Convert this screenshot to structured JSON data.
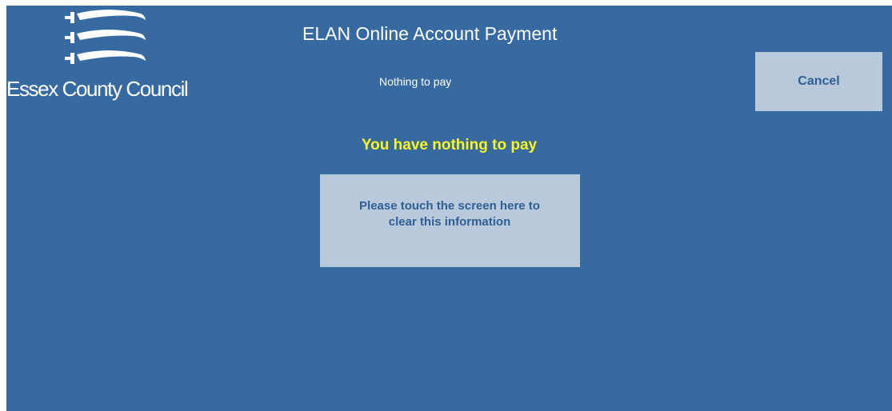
{
  "header": {
    "logo_text": "Essex County Council",
    "title": "ELAN Online Account Payment",
    "subtitle": "Nothing to pay",
    "cancel_label": "Cancel"
  },
  "main": {
    "message": "You have nothing to pay",
    "clear_label": "Please touch the screen here to clear this information"
  },
  "colors": {
    "background": "#376aa1",
    "button_fill": "#b9c9dc",
    "button_text": "#2f5e95",
    "message_text": "#fbf720",
    "logo": "#ffffff"
  },
  "icons": {
    "logo_mark": "three-seaxes-icon"
  }
}
